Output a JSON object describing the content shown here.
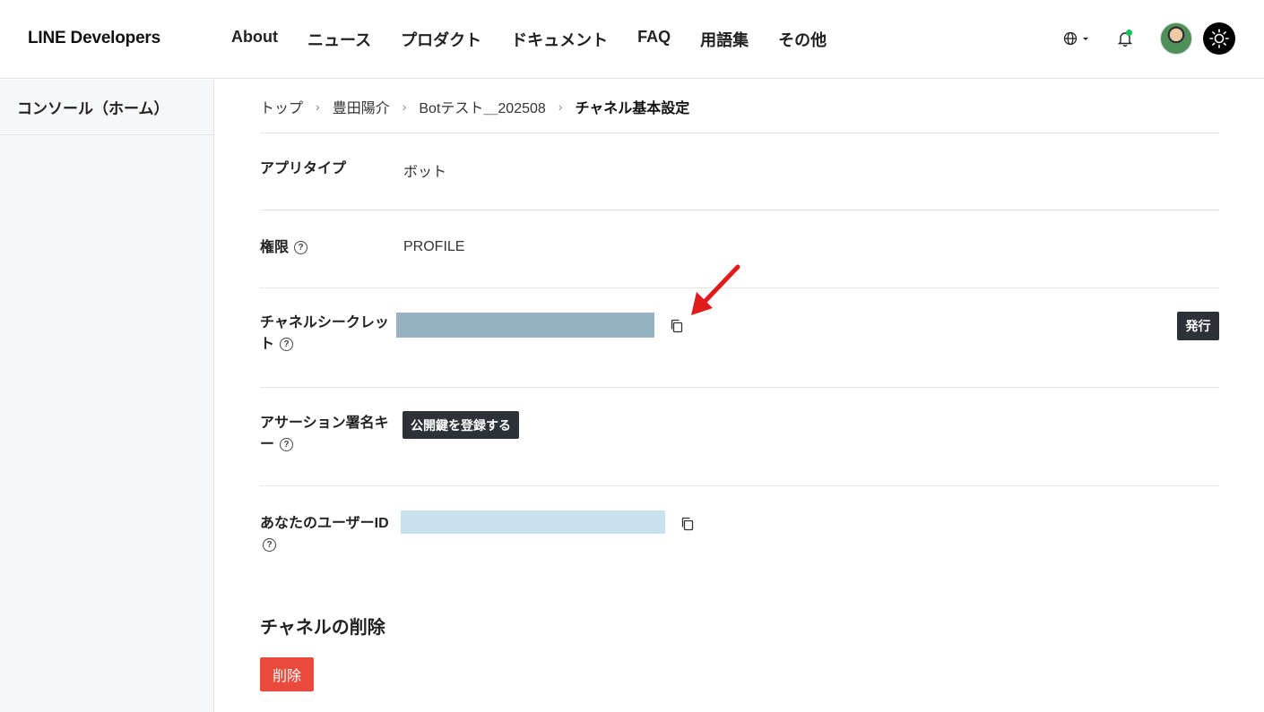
{
  "header": {
    "logo": "LINE Developers",
    "nav": [
      "About",
      "ニュース",
      "プロダクト",
      "ドキュメント",
      "FAQ",
      "用語集",
      "その他"
    ],
    "icons": {
      "language": "globe-icon",
      "notification": "bell-icon",
      "theme": "sun-icon"
    },
    "accent": "#06c755"
  },
  "sidebar": {
    "items": [
      {
        "label": "コンソール（ホーム）"
      }
    ]
  },
  "breadcrumb": {
    "items": [
      "トップ",
      "豊田陽介",
      "Botテスト＿202508"
    ],
    "current": "チャネル基本設定"
  },
  "settings": {
    "app_type": {
      "label": "アプリタイプ",
      "value": "ボット"
    },
    "permission": {
      "label": "権限",
      "value": "PROFILE"
    },
    "channel_secret": {
      "label_line1": "チャネルシークレッ",
      "label_line2": "ト",
      "issue_button": "発行"
    },
    "assertion_key": {
      "label_line1": "アサーション署名キ",
      "label_line2": "ー",
      "register_button": "公開鍵を登録する"
    },
    "user_id": {
      "label": "あなたのユーザーID"
    }
  },
  "delete_section": {
    "title": "チャネルの削除",
    "button": "削除",
    "button_color": "#ea4a3c"
  }
}
